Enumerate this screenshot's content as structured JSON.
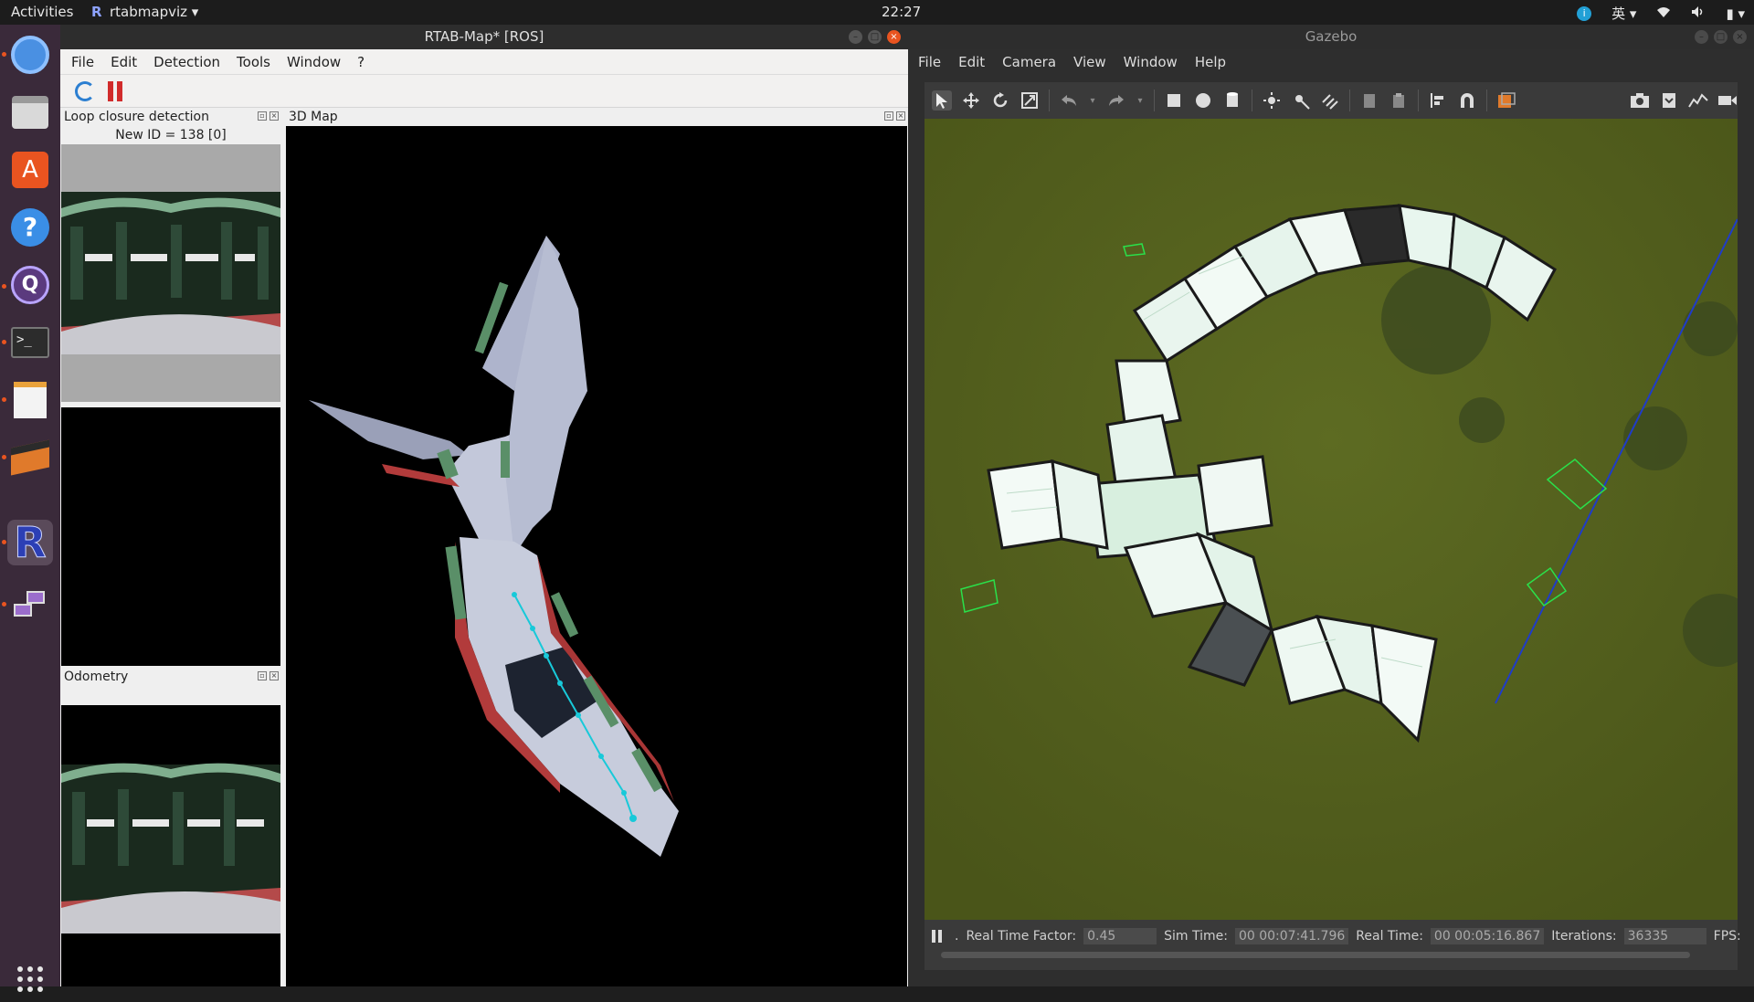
{
  "topbar": {
    "activities": "Activities",
    "app_menu": "rtabmapviz",
    "clock": "22:27",
    "input_method": "英"
  },
  "dock": {
    "items": [
      "chromium-icon",
      "files-icon",
      "software-center-icon",
      "help-icon",
      "qt-icon",
      "terminal-icon",
      "text-editor-icon",
      "rviz-icon",
      "rtabmap-icon",
      "network-icon",
      "apps-grid-icon"
    ]
  },
  "rtab": {
    "title": "RTAB-Map* [ROS]",
    "menu": [
      "File",
      "Edit",
      "Detection",
      "Tools",
      "Window",
      "?"
    ],
    "loop_panel": {
      "title": "Loop closure detection",
      "status": "New ID = 138 [0]"
    },
    "map_panel": {
      "title": "3D Map"
    },
    "odom_panel": {
      "title": "Odometry"
    }
  },
  "gazebo": {
    "title": "Gazebo",
    "menu": [
      "File",
      "Edit",
      "Camera",
      "View",
      "Window",
      "Help"
    ],
    "status": {
      "rtf_label": "Real Time Factor:",
      "rtf_value": "0.45",
      "sim_label": "Sim Time:",
      "sim_value": "00 00:07:41.796",
      "real_label": "Real Time:",
      "real_value": "00 00:05:16.867",
      "iter_label": "Iterations:",
      "iter_value": "36335",
      "fps_label": "FPS:"
    }
  }
}
